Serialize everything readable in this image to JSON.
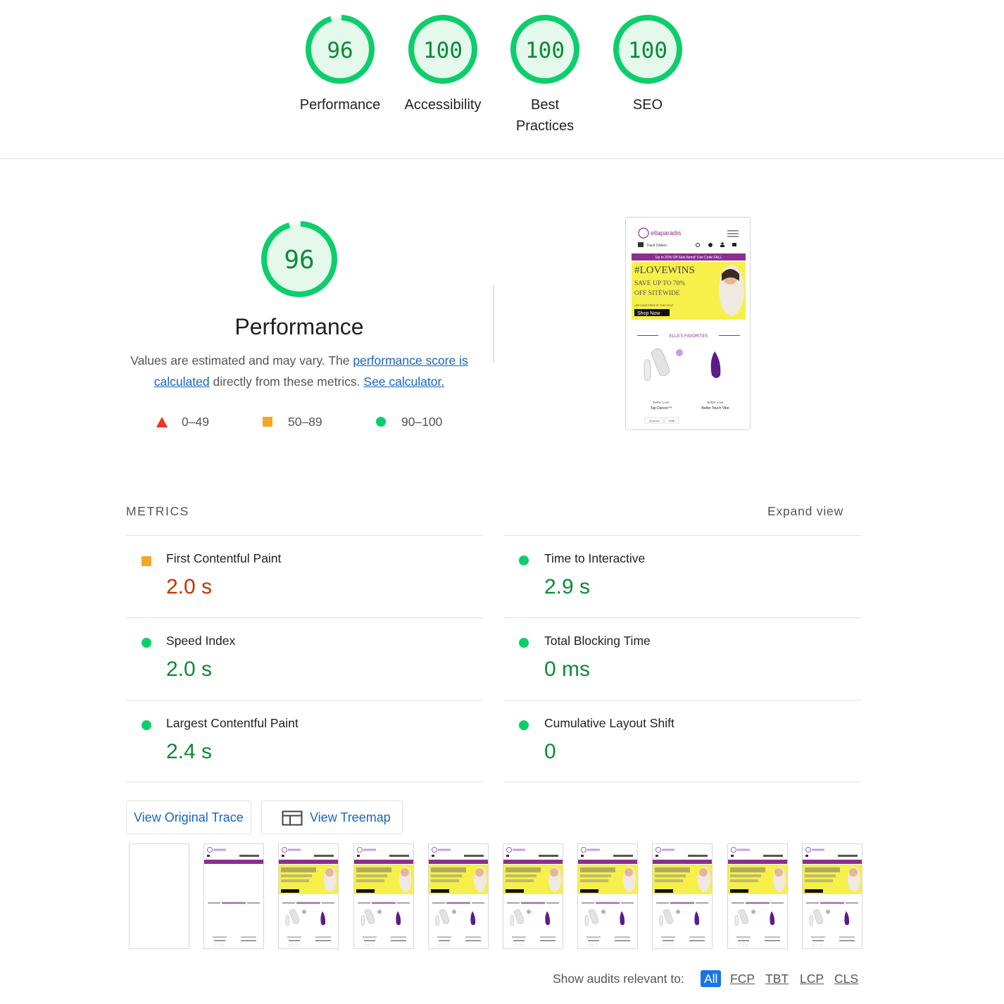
{
  "top_gauges": [
    {
      "score": "96",
      "label": "Performance",
      "fraction": 0.96
    },
    {
      "score": "100",
      "label": "Accessibility",
      "fraction": 1.0
    },
    {
      "score": "100",
      "label": "Best Practices",
      "fraction": 1.0
    },
    {
      "score": "100",
      "label": "SEO",
      "fraction": 1.0
    }
  ],
  "performance": {
    "score": "96",
    "fraction": 0.96,
    "title": "Performance",
    "desc_prefix": "Values are estimated and may vary. The ",
    "desc_link": "performance score is calculated",
    "desc_mid": " directly from these metrics. ",
    "desc_calc": "See calculator.",
    "legend": [
      {
        "range": "0–49",
        "shape": "triangle",
        "color": "#f23322"
      },
      {
        "range": "50–89",
        "shape": "square",
        "color": "#f5a623"
      },
      {
        "range": "90–100",
        "shape": "circle",
        "color": "#0cce6b"
      }
    ]
  },
  "screenshot": {
    "brand": "ellaparadis",
    "track": "Track Orders",
    "promo": "Up to 20% Off Sale Items! Use Code FALL",
    "hero_line1": "#LOVEWINS",
    "hero_line2": "SAVE UP TO 70%",
    "hero_line3": "OFF SITEWIDE",
    "hero_small": "USE CODE PRIDE AT CHECKOUT",
    "hero_cta": "Shop Now",
    "section": "ELLA'S FAVORITES",
    "product1_brand": "Better Love",
    "product1_name": "Tap Dancer™",
    "product2_brand": "Better Love",
    "product2_name": "Better Touch Vibe",
    "swatch1": "Turquoise",
    "swatch2": "White"
  },
  "metrics": {
    "heading": "METRICS",
    "expand": "Expand view",
    "items": [
      {
        "name": "First Contentful Paint",
        "value": "2.0 s",
        "status": "average"
      },
      {
        "name": "Time to Interactive",
        "value": "2.9 s",
        "status": "good"
      },
      {
        "name": "Speed Index",
        "value": "2.0 s",
        "status": "good"
      },
      {
        "name": "Total Blocking Time",
        "value": "0 ms",
        "status": "good"
      },
      {
        "name": "Largest Contentful Paint",
        "value": "2.4 s",
        "status": "good"
      },
      {
        "name": "Cumulative Layout Shift",
        "value": "0",
        "status": "good"
      }
    ]
  },
  "buttons": {
    "trace": "View Original Trace",
    "treemap": "View Treemap"
  },
  "filter": {
    "label": "Show audits relevant to:",
    "chips": [
      "All",
      "FCP",
      "TBT",
      "LCP",
      "CLS"
    ],
    "active": "All"
  },
  "colors": {
    "good": "#0cce6b",
    "good_text": "#0b8a34",
    "average": "#f5a623",
    "average_text": "#c33300",
    "link": "#1565c0",
    "purple": "#8b2f8f",
    "hero_yellow": "#f7ef4a"
  }
}
